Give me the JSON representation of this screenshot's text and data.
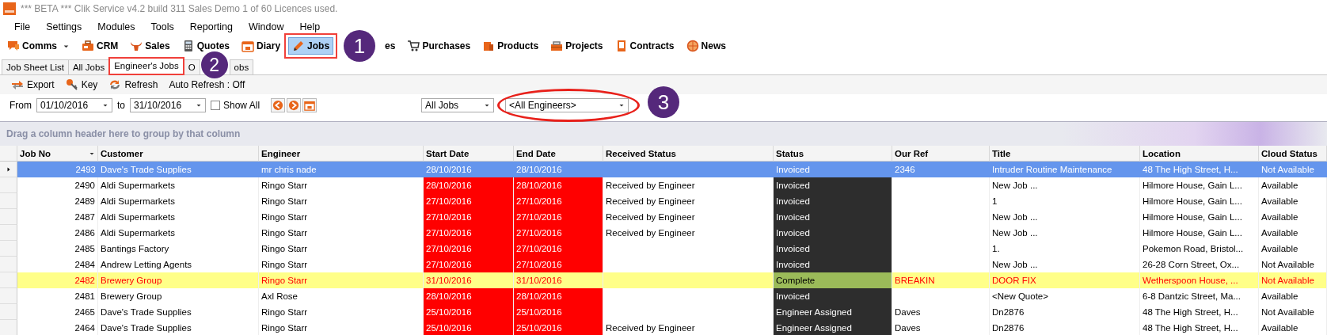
{
  "window": {
    "title": "*** BETA *** Clik Service v4.2 build 311  Sales Demo 1 of 60 Licences used."
  },
  "menu": [
    "File",
    "Settings",
    "Modules",
    "Tools",
    "Reporting",
    "Window",
    "Help"
  ],
  "toolbar": [
    {
      "kind": "button",
      "label": "Comms",
      "dropdown": true,
      "selected": false,
      "annotated": false
    },
    {
      "kind": "button",
      "label": "CRM",
      "dropdown": false,
      "selected": false,
      "annotated": false
    },
    {
      "kind": "button",
      "label": "Sales",
      "dropdown": false,
      "selected": false,
      "annotated": false
    },
    {
      "kind": "button",
      "label": "Quotes",
      "dropdown": false,
      "selected": false,
      "annotated": false
    },
    {
      "kind": "button",
      "label": "Diary",
      "dropdown": false,
      "selected": false,
      "annotated": false
    },
    {
      "kind": "button",
      "label": "Jobs",
      "dropdown": false,
      "selected": true,
      "annotated": true
    },
    {
      "kind": "badge",
      "label": "1"
    },
    {
      "kind": "button",
      "label": "es",
      "dropdown": false,
      "selected": false,
      "annotated": false
    },
    {
      "kind": "button",
      "label": "Purchases",
      "dropdown": false,
      "selected": false,
      "annotated": false
    },
    {
      "kind": "button",
      "label": "Products",
      "dropdown": false,
      "selected": false,
      "annotated": false
    },
    {
      "kind": "button",
      "label": "Projects",
      "dropdown": false,
      "selected": false,
      "annotated": false
    },
    {
      "kind": "button",
      "label": "Contracts",
      "dropdown": false,
      "selected": false,
      "annotated": false
    },
    {
      "kind": "button",
      "label": "News",
      "dropdown": false,
      "selected": false,
      "annotated": false
    }
  ],
  "tabs": [
    {
      "kind": "tab",
      "label": "Job Sheet List",
      "selected": false,
      "annotated": false
    },
    {
      "kind": "tab",
      "label": "All Jobs",
      "selected": false,
      "annotated": false
    },
    {
      "kind": "tab",
      "label": "Engineer's Jobs",
      "selected": true,
      "annotated": true
    },
    {
      "kind": "tab",
      "label": "O",
      "selected": false,
      "annotated": false
    },
    {
      "kind": "badge",
      "label": "2"
    },
    {
      "kind": "tab",
      "label": "obs",
      "selected": false,
      "annotated": false
    }
  ],
  "actions": [
    {
      "label": "Export"
    },
    {
      "label": "Key"
    },
    {
      "label": "Refresh"
    },
    {
      "label": "Auto Refresh : Off"
    }
  ],
  "filters": {
    "from_label": "From",
    "from_date": "01/10/2016",
    "to_label": "to",
    "to_date": "31/10/2016",
    "show_all": {
      "label": "Show All",
      "checked": false
    },
    "job_filter": "All Jobs",
    "engineer_filter": {
      "value": "<All  Engineers>",
      "annotated": true
    },
    "badge": "3"
  },
  "group_panel": {
    "hint": "Drag a column header here to group by that column"
  },
  "table": {
    "columns": [
      "Job No",
      "Customer",
      "Engineer",
      "Start Date",
      "End Date",
      "Received Status",
      "Status",
      "Our Ref",
      "Title",
      "Location",
      "Cloud Status"
    ],
    "rows": [
      {
        "cells": [
          "2493",
          "Dave's Trade Supplies",
          "mr chris nade",
          "28/10/2016",
          "28/10/2016",
          "",
          "Invoiced",
          "2346",
          "Intruder Routine Maintenance",
          "48 The High Street, H...",
          "Not Available"
        ],
        "selected": true,
        "flagged": false,
        "overdue": false
      },
      {
        "cells": [
          "2490",
          "Aldi Supermarkets",
          "Ringo Starr",
          "28/10/2016",
          "28/10/2016",
          "Received by Engineer",
          "Invoiced",
          "",
          "New Job ...",
          "Hilmore House, Gain L...",
          "Available"
        ],
        "selected": false,
        "flagged": false,
        "overdue": true
      },
      {
        "cells": [
          "2489",
          "Aldi Supermarkets",
          "Ringo Starr",
          "27/10/2016",
          "27/10/2016",
          "Received by Engineer",
          "Invoiced",
          "",
          "1",
          "Hilmore House, Gain L...",
          "Available"
        ],
        "selected": false,
        "flagged": false,
        "overdue": true
      },
      {
        "cells": [
          "2487",
          "Aldi Supermarkets",
          "Ringo Starr",
          "27/10/2016",
          "27/10/2016",
          "Received by Engineer",
          "Invoiced",
          "",
          "New Job ...",
          "Hilmore House, Gain L...",
          "Available"
        ],
        "selected": false,
        "flagged": false,
        "overdue": true
      },
      {
        "cells": [
          "2486",
          "Aldi Supermarkets",
          "Ringo Starr",
          "27/10/2016",
          "27/10/2016",
          "Received by Engineer",
          "Invoiced",
          "",
          "New Job ...",
          "Hilmore House, Gain L...",
          "Available"
        ],
        "selected": false,
        "flagged": false,
        "overdue": true
      },
      {
        "cells": [
          "2485",
          "Bantings Factory",
          "Ringo Starr",
          "27/10/2016",
          "27/10/2016",
          "",
          "Invoiced",
          "",
          "1.",
          "Pokemon Road, Bristol...",
          "Available"
        ],
        "selected": false,
        "flagged": false,
        "overdue": true
      },
      {
        "cells": [
          "2484",
          "Andrew Letting Agents",
          "Ringo Starr",
          "27/10/2016",
          "27/10/2016",
          "",
          "Invoiced",
          "",
          "New Job ...",
          "26-28 Corn Street, Ox...",
          "Not Available"
        ],
        "selected": false,
        "flagged": false,
        "overdue": true
      },
      {
        "cells": [
          "2482",
          "Brewery Group",
          "Ringo Starr",
          "31/10/2016",
          "31/10/2016",
          "",
          "Complete",
          "BREAKIN",
          "DOOR FIX",
          "Wetherspoon House, ...",
          "Not Available"
        ],
        "selected": false,
        "flagged": true,
        "overdue": false
      },
      {
        "cells": [
          "2481",
          "Brewery Group",
          "Axl Rose",
          "28/10/2016",
          "28/10/2016",
          "",
          "Invoiced",
          "",
          "<New Quote>",
          "6-8 Dantzic Street, Ma...",
          "Available"
        ],
        "selected": false,
        "flagged": false,
        "overdue": true
      },
      {
        "cells": [
          "2465",
          "Dave's Trade Supplies",
          "Ringo Starr",
          "25/10/2016",
          "25/10/2016",
          "",
          "Engineer Assigned",
          "Daves",
          "Dn2876",
          "48 The High Street, H...",
          "Not Available"
        ],
        "selected": false,
        "flagged": false,
        "overdue": true
      },
      {
        "cells": [
          "2464",
          "Dave's Trade Supplies",
          "Ringo Starr",
          "25/10/2016",
          "25/10/2016",
          "Received by Engineer",
          "Engineer Assigned",
          "Daves",
          "Dn2876",
          "48 The High Street, H...",
          "Available"
        ],
        "selected": false,
        "flagged": false,
        "overdue": true
      }
    ]
  }
}
